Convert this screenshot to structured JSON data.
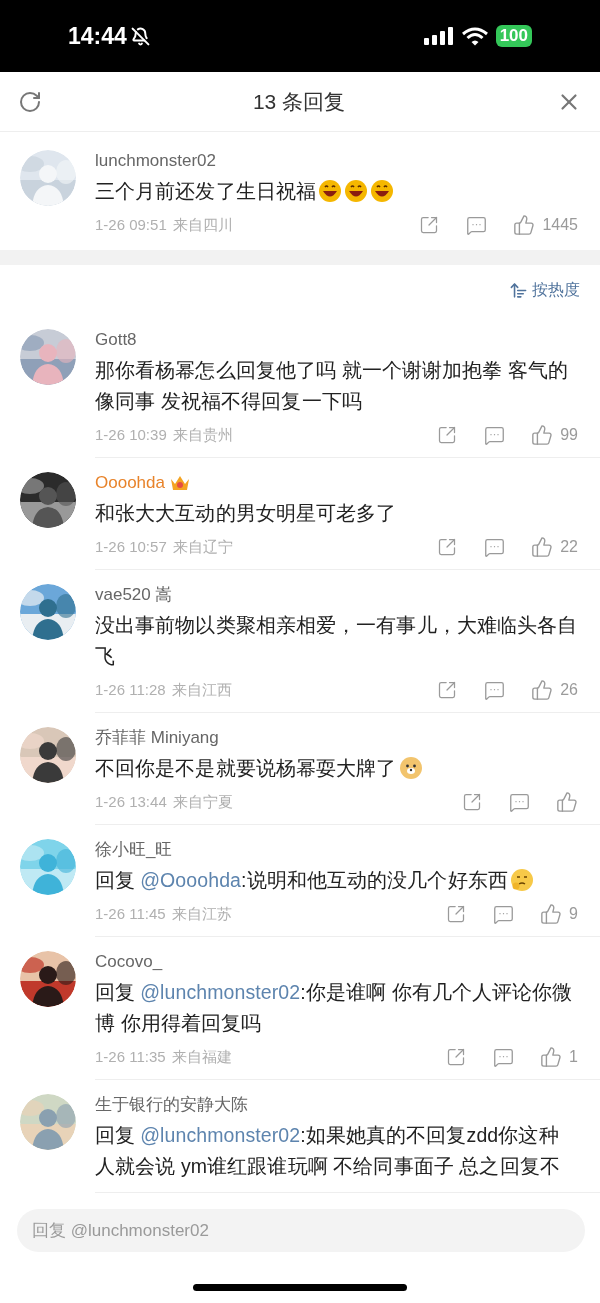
{
  "status_bar": {
    "time": "14:44",
    "battery": "100"
  },
  "header": {
    "title": "13 条回复"
  },
  "main_comment": {
    "name": "lunchmonster02",
    "vip": false,
    "text": "三个月前还发了生日祝福",
    "emojis": [
      {
        "kind": "laugh"
      },
      {
        "kind": "laugh"
      },
      {
        "kind": "laugh"
      }
    ],
    "time": "1-26 09:51",
    "location": "来自四川",
    "likes": "1445"
  },
  "sort": {
    "label": "按热度"
  },
  "comments": [
    {
      "name": "Gott8",
      "vip": false,
      "text": "那你看杨幂怎么回复他了吗 就一个谢谢加抱拳 客气的像同事 发祝福不得回复一下吗",
      "time": "1-26 10:39",
      "location": "来自贵州",
      "likes": "99"
    },
    {
      "name": "Oooohda",
      "vip": true,
      "text": "和张大大互动的男女明星可老多了",
      "time": "1-26 10:57",
      "location": "来自辽宁",
      "likes": "22"
    },
    {
      "name": "vae520 嵩",
      "vip": false,
      "text": "没出事前物以类聚相亲相爱，一有事儿，大难临头各自飞",
      "time": "1-26 11:28",
      "location": "来自江西",
      "likes": "26"
    },
    {
      "name": "乔菲菲 Miniyang",
      "vip": false,
      "text": "不回你是不是就要说杨幂耍大牌了",
      "emojis": [
        {
          "kind": "dog"
        }
      ],
      "time": "1-26 13:44",
      "location": "来自宁夏"
    },
    {
      "name": "徐小旺_旺",
      "vip": false,
      "reply_prefix": "回复",
      "mention": "@Oooohda",
      "text": ":说明和他互动的没几个好东西",
      "emojis": [
        {
          "kind": "think"
        }
      ],
      "time": "1-26 11:45",
      "location": "来自江苏",
      "likes": "9"
    },
    {
      "name": "Cocovo_",
      "vip": false,
      "reply_prefix": "回复",
      "mention": "@lunchmonster02",
      "text": ":你是谁啊 你有几个人评论你微博 你用得着回复吗",
      "time": "1-26 11:35",
      "location": "来自福建",
      "likes": "1"
    },
    {
      "name": "生于银行的安静大陈",
      "vip": false,
      "reply_prefix": "回复",
      "mention": "@lunchmonster02",
      "text": ":如果她真的不回复zdd你这种人就会说 ym谁红跟谁玩啊 不给同事面子 总之回复不"
    }
  ],
  "reply_field": {
    "placeholder": "回复 @lunchmonster02"
  }
}
